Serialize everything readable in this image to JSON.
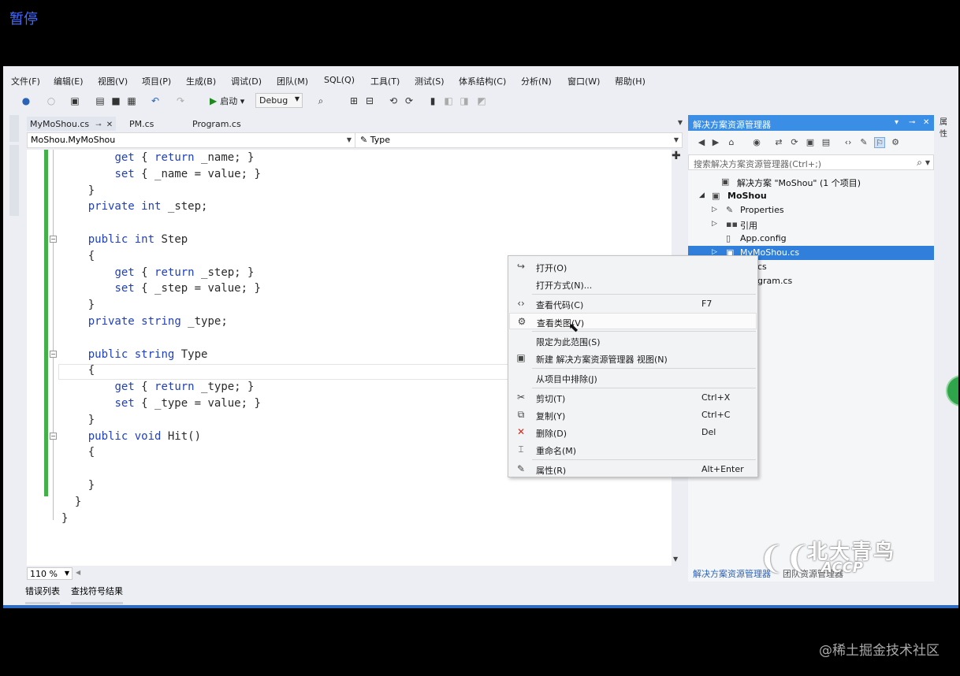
{
  "overlay": {
    "pause_label": "暂停",
    "watermark": "@稀土掘金技术社区"
  },
  "menubar": [
    "文件(F)",
    "编辑(E)",
    "视图(V)",
    "项目(P)",
    "生成(B)",
    "调试(D)",
    "团队(M)",
    "SQL(Q)",
    "工具(T)",
    "测试(S)",
    "体系结构(C)",
    "分析(N)",
    "窗口(W)",
    "帮助(H)"
  ],
  "toolbar": {
    "start_label": "启动",
    "config": "Debug"
  },
  "tabs": [
    {
      "label": "MyMoShou.cs",
      "active": true
    },
    {
      "label": "PM.cs",
      "active": false
    },
    {
      "label": "Program.cs",
      "active": false
    }
  ],
  "navbar": {
    "left": "MoShou.MyMoShou",
    "right": "Type"
  },
  "code": [
    "        get { return _name; }",
    "        set { _name = value; }",
    "    }",
    "    private int _step;",
    "",
    "    public int Step",
    "    {",
    "        get { return _step; }",
    "        set { _step = value; }",
    "    }",
    "    private string _type;",
    "",
    "    public string Type",
    "    {",
    "        get { return _type; }",
    "        set { _type = value; }",
    "    }",
    "    public void Hit()",
    "    {",
    "",
    "    }",
    "  }",
    "}"
  ],
  "zoom": "110 %",
  "bottom_tabs": [
    "错误列表",
    "查找符号结果"
  ],
  "solution_explorer": {
    "title": "解决方案资源管理器",
    "search_placeholder": "搜索解决方案资源管理器(Ctrl+;)",
    "tree": [
      {
        "label": "解决方案 \"MoShou\" (1 个项目)",
        "icon": "solution-icon",
        "level": 0
      },
      {
        "label": "MoShou",
        "icon": "project-icon",
        "level": 1,
        "bold": true
      },
      {
        "label": "Properties",
        "icon": "wrench-icon",
        "level": 2
      },
      {
        "label": "引用",
        "icon": "references-icon",
        "level": 2
      },
      {
        "label": "App.config",
        "icon": "file-icon",
        "level": 2
      },
      {
        "label": "MyMoShou.cs",
        "icon": "csharp-file-icon",
        "level": 2,
        "selected": true
      },
      {
        "label": "cs",
        "icon": "",
        "level": 2
      },
      {
        "label": "gram.cs",
        "icon": "",
        "level": 2
      }
    ],
    "bottom_tabs": [
      "解决方案资源管理器",
      "团队资源管理器"
    ]
  },
  "right_strip": "属性",
  "logo": {
    "line1": "北大青鸟",
    "line2": "ACCP"
  },
  "context_menu": [
    {
      "label": "打开(O)",
      "shortcut": "",
      "icon": "open-icon"
    },
    {
      "label": "打开方式(N)...",
      "shortcut": "",
      "icon": ""
    },
    {
      "label": "查看代码(C)",
      "shortcut": "F7",
      "icon": "code-icon"
    },
    {
      "label": "查看类图(V)",
      "shortcut": "",
      "icon": "class-diagram-icon",
      "hover": true
    },
    {
      "label": "限定为此范围(S)",
      "shortcut": "",
      "icon": ""
    },
    {
      "label": "新建 解决方案资源管理器 视图(N)",
      "shortcut": "",
      "icon": "new-view-icon"
    },
    {
      "label": "从项目中排除(J)",
      "shortcut": "",
      "icon": ""
    },
    {
      "label": "剪切(T)",
      "shortcut": "Ctrl+X",
      "icon": "cut-icon"
    },
    {
      "label": "复制(Y)",
      "shortcut": "Ctrl+C",
      "icon": "copy-icon"
    },
    {
      "label": "删除(D)",
      "shortcut": "Del",
      "icon": "delete-icon"
    },
    {
      "label": "重命名(M)",
      "shortcut": "",
      "icon": "rename-icon"
    },
    {
      "label": "属性(R)",
      "shortcut": "Alt+Enter",
      "icon": "properties-icon"
    }
  ]
}
